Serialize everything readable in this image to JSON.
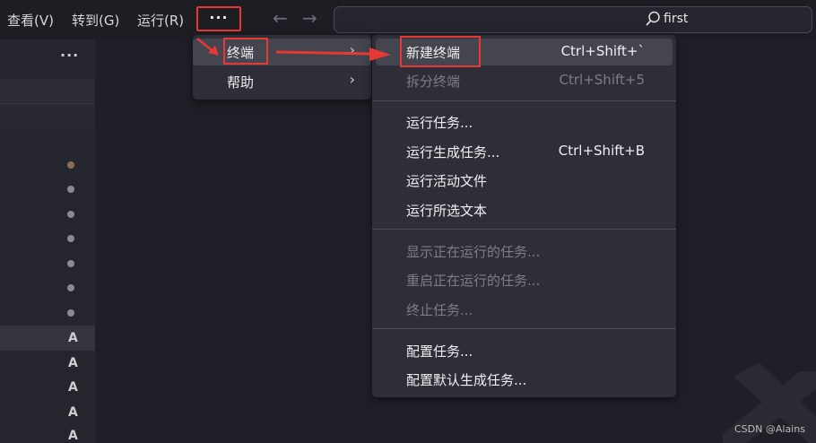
{
  "menubar": {
    "items": [
      "查看(V)",
      "转到(G)",
      "运行(R)"
    ],
    "more": "···"
  },
  "nav": {
    "back": "←",
    "forward": "→"
  },
  "search": {
    "value": "first"
  },
  "sidebar": {
    "more": "···",
    "letters": [
      "A",
      "A",
      "A",
      "A",
      "A"
    ]
  },
  "menu_level1": {
    "items": [
      {
        "label": "终端",
        "chevron": "›"
      },
      {
        "label": "帮助",
        "chevron": "›"
      }
    ]
  },
  "terminal_menu": {
    "new_terminal": {
      "label": "新建终端",
      "shortcut": "Ctrl+Shift+`"
    },
    "split_terminal": {
      "label": "拆分终端",
      "shortcut": "Ctrl+Shift+5"
    },
    "run_task": {
      "label": "运行任务..."
    },
    "run_build_task": {
      "label": "运行生成任务...",
      "shortcut": "Ctrl+Shift+B"
    },
    "run_active_file": {
      "label": "运行活动文件"
    },
    "run_selected_text": {
      "label": "运行所选文本"
    },
    "show_running_tasks": {
      "label": "显示正在运行的任务..."
    },
    "restart_running_task": {
      "label": "重启正在运行的任务..."
    },
    "terminate_task": {
      "label": "终止任务..."
    },
    "configure_tasks": {
      "label": "配置任务..."
    },
    "configure_default_build": {
      "label": "配置默认生成任务..."
    }
  },
  "watermark": "CSDN @Alains",
  "colors": {
    "annotation": "#e53935",
    "menu_bg": "#2e2e38",
    "active_item": "#45454f"
  }
}
